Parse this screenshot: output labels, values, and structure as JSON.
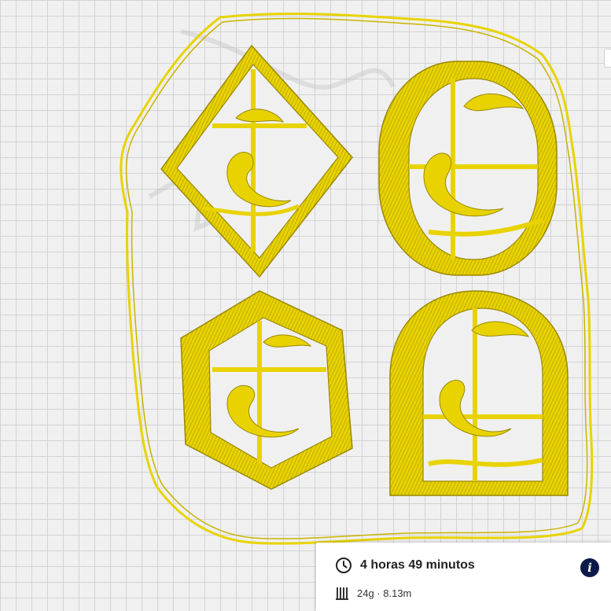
{
  "viewport": {
    "accent_color": "#e8d300",
    "outline_color": "#c9b400",
    "objects": [
      {
        "shape": "diamond"
      },
      {
        "shape": "oval"
      },
      {
        "shape": "hexagon"
      },
      {
        "shape": "arch"
      }
    ]
  },
  "print_info": {
    "time_icon": "clock-icon",
    "print_time": "4 horas 49 minutos",
    "material_icon": "filament-icon",
    "material": "24g · 8.13m",
    "info_icon": "info-icon",
    "info_label": "i"
  }
}
